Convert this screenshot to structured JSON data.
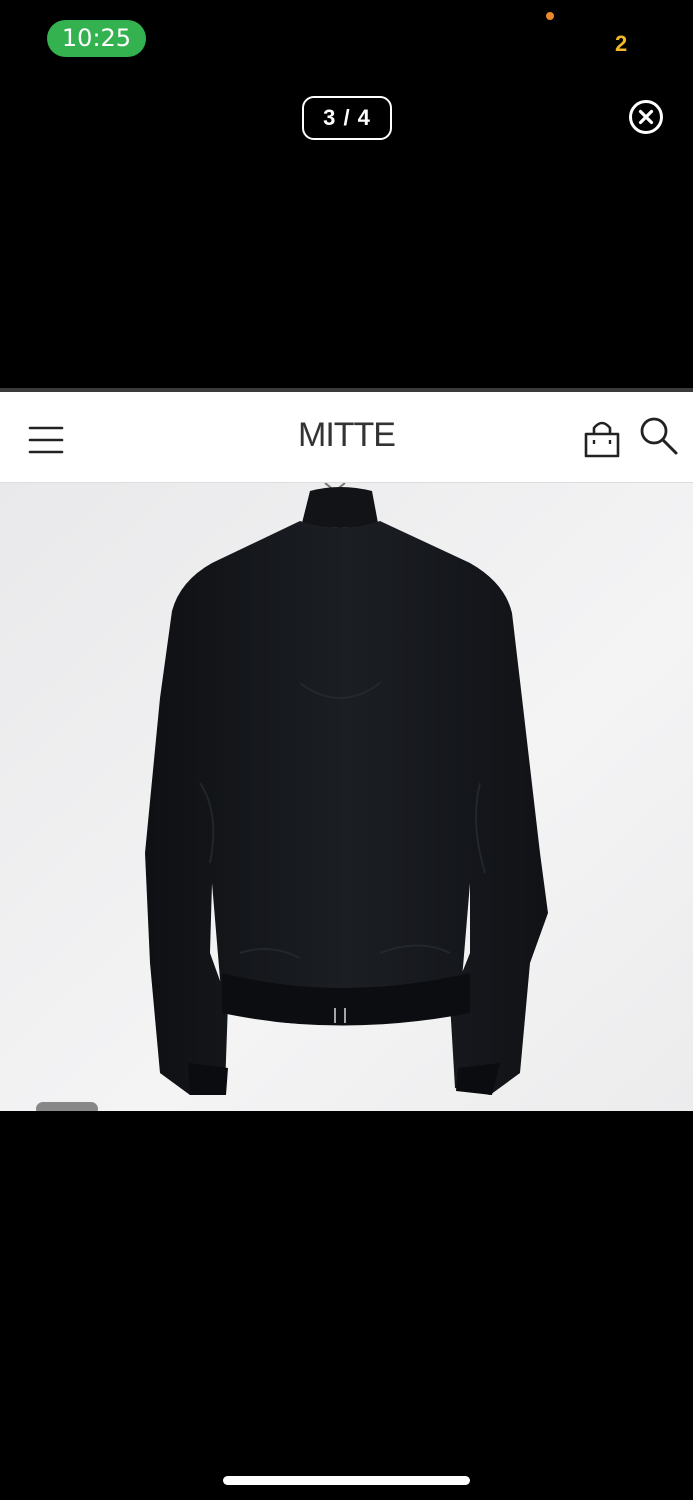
{
  "status_bar": {
    "time": "10:25",
    "battery_fragment": "2"
  },
  "viewer": {
    "page_counter": "3 / 4"
  },
  "site": {
    "brand": "MITTE"
  },
  "icons": {
    "menu": "hamburger-menu-icon",
    "bag": "shopping-bag-icon",
    "search": "search-icon",
    "close": "close-circle-icon"
  },
  "colors": {
    "time_pill": "#34b24f",
    "privacy_dot": "#e8892a",
    "battery": "#f2b825"
  }
}
